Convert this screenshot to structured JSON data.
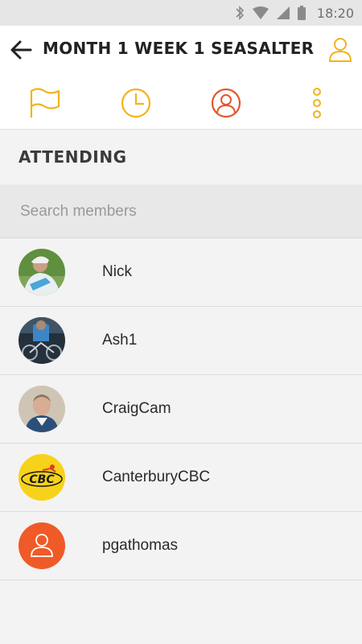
{
  "status_bar": {
    "time": "18:20"
  },
  "header": {
    "title": "MONTH 1 WEEK 1   SEASALTER"
  },
  "tabs": [
    {
      "icon": "flag-icon",
      "color": "#f2b31b"
    },
    {
      "icon": "clock-icon",
      "color": "#f2b31b"
    },
    {
      "icon": "person-icon",
      "color": "#e2572a",
      "active": true
    },
    {
      "icon": "more-vertical-icon",
      "color": "#f2b31b"
    }
  ],
  "section": {
    "title": "ATTENDING"
  },
  "search": {
    "placeholder": "Search members",
    "value": ""
  },
  "members": [
    {
      "name": "Nick"
    },
    {
      "name": "Ash1"
    },
    {
      "name": "CraigCam"
    },
    {
      "name": "CanterburyCBC",
      "logo_text": "CBC"
    },
    {
      "name": "pgathomas"
    }
  ],
  "colors": {
    "accent_yellow": "#f2b31b",
    "accent_orange": "#e2572a"
  }
}
